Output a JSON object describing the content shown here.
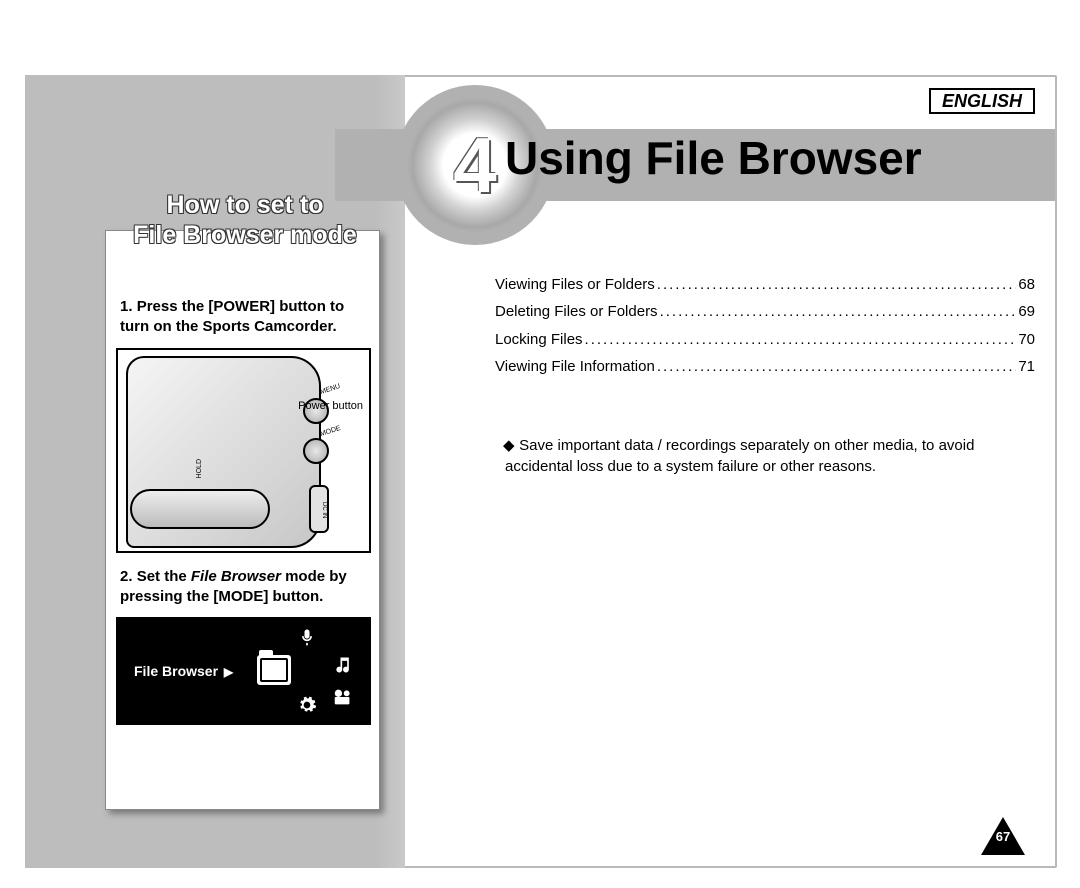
{
  "language_label": "ENGLISH",
  "chapter": {
    "number": "4",
    "title": "Using File Browser"
  },
  "toc": [
    {
      "label": "Viewing Files or Folders",
      "page": "68"
    },
    {
      "label": "Deleting Files or Folders",
      "page": "69"
    },
    {
      "label": "Locking Files",
      "page": "70"
    },
    {
      "label": "Viewing File Information",
      "page": "71"
    }
  ],
  "note_bullet": "◆",
  "note_text": "Save important data / recordings separately on other media, to avoid accidental loss due to a system failure or other reasons.",
  "sidebar": {
    "heading_line1": "How to set to",
    "heading_line2": "File Browser mode",
    "step1_num": "1.",
    "step1_text": "Press the [POWER] button to turn on the Sports Camcorder.",
    "step2_num": "2.",
    "step2_pre": "Set the ",
    "step2_em": "File Browser",
    "step2_post": " mode by pressing the [MODE] button.",
    "illustration": {
      "power_label": "Power button",
      "menu_label": "MENU",
      "mode_label": "MODE",
      "hold_label": "HOLD",
      "dcin_label": "DC IN"
    },
    "mode_selector": {
      "label": "File Browser",
      "arrow": "▶",
      "icons": {
        "mic": "mic-icon",
        "music": "music-icon",
        "folder": "folder-icon",
        "gear": "gear-icon",
        "video": "video-icon"
      }
    }
  },
  "page_number": "67"
}
